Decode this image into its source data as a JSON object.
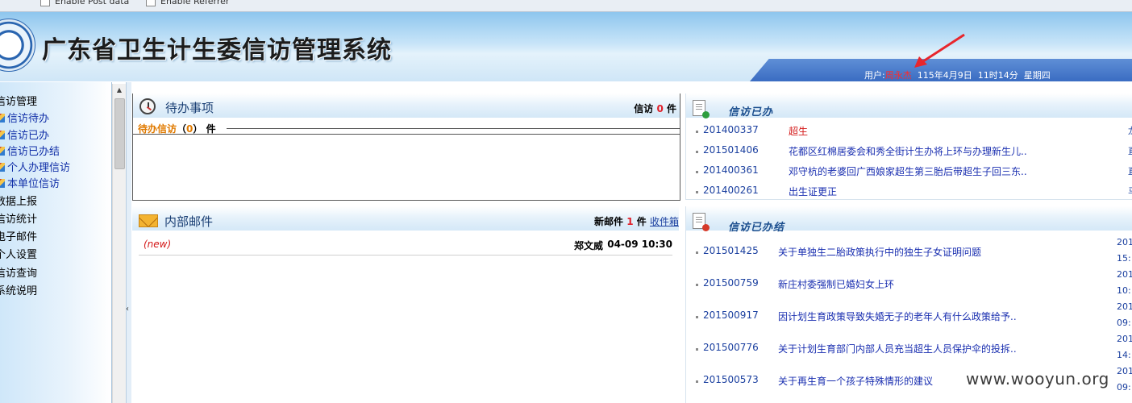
{
  "topbar": {
    "options": [
      "Enable Post data",
      "Enable Referrer"
    ]
  },
  "header": {
    "title": "广东省卫生计生委信访管理系统",
    "user_label": "用户:",
    "user_name": "周永杰",
    "date": "115年4月9日",
    "time": "11时14分",
    "weekday": "星期四"
  },
  "sidebar": {
    "group_title": "信访管理",
    "items": [
      "信访待办",
      "信访已办",
      "信访已办结",
      "个人办理信访",
      "本单位信访"
    ],
    "sections": [
      "数据上报",
      "信访统计",
      "电子邮件",
      "个人设置",
      "信访查询",
      "系统说明"
    ]
  },
  "todo": {
    "title": "待办事项",
    "summary_label": "信访",
    "summary_count": "0",
    "summary_unit": "件",
    "pending_label": "待办信访",
    "pending_open": "（",
    "pending_count": "0",
    "pending_close": "）",
    "pending_unit": "件"
  },
  "done": {
    "title": "信访已办",
    "rows": [
      {
        "id": "201400337",
        "subject": "超生",
        "cut": "龙"
      },
      {
        "id": "201501406",
        "subject": "花都区红棉居委会和秀全街计生办将上环与办理新生儿..",
        "cut": "直"
      },
      {
        "id": "201400361",
        "subject": "邓守杭的老婆回广西娘家超生第三胎后带超生子回三东..",
        "cut": "直"
      },
      {
        "id": "201400261",
        "subject": "出生证更正",
        "cut": "马"
      }
    ]
  },
  "mail": {
    "title": "内部邮件",
    "new_label": "新邮件",
    "new_count": "1",
    "new_unit": "件",
    "inbox_link": "收件箱",
    "items": [
      {
        "tag": "(new)",
        "sender": "郑文威",
        "time": "04-09 10:30"
      }
    ]
  },
  "closed": {
    "title": "信访已办结",
    "rows": [
      {
        "id": "201501425",
        "subject": "关于单独生二胎政策执行中的独生子女证明问题",
        "date": "201",
        "time": "15:"
      },
      {
        "id": "201500759",
        "subject": "新庄村委强制已婚妇女上环",
        "date": "201",
        "time": "10:"
      },
      {
        "id": "201500917",
        "subject": "因计划生育政策导致失婚无子的老年人有什么政策给予..",
        "date": "201",
        "time": "09:"
      },
      {
        "id": "201500776",
        "subject": "关于计划生育部门内部人员充当超生人员保护伞的投拆..",
        "date": "201",
        "time": "14:"
      },
      {
        "id": "201500573",
        "subject": "关于再生育一个孩子特殊情形的建议",
        "date": "201",
        "time": "09:"
      }
    ]
  },
  "watermark": "www.wooyun.org",
  "colors": {
    "accent": "#1a3f9f",
    "alert": "#e0202a",
    "banner_bar": "#3a6cc2"
  }
}
